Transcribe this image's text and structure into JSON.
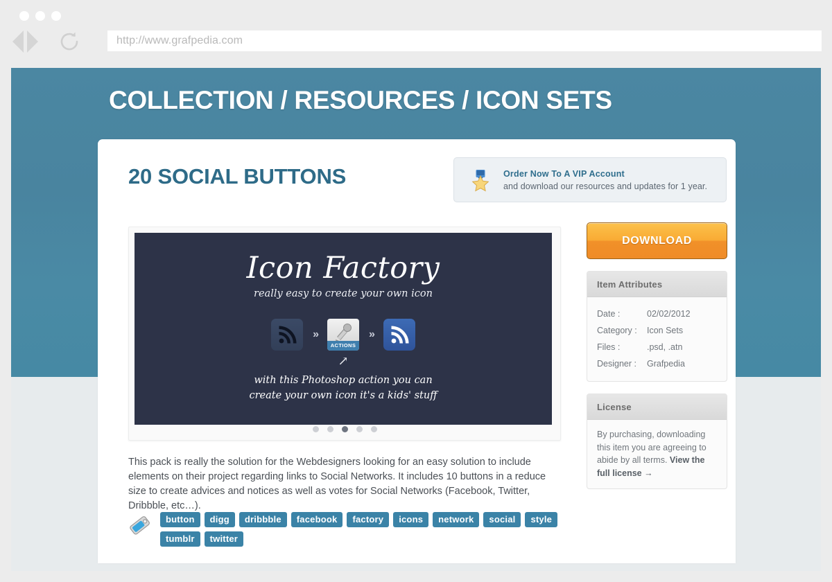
{
  "browser": {
    "url": "http://www.grafpedia.com",
    "url_placeholder": "http://www.grafpedia.com",
    "back_icon": "back-triangle-icon",
    "forward_icon": "forward-triangle-icon",
    "reload_icon": "reload-icon"
  },
  "hero": {
    "breadcrumb": "COLLECTION / RESOURCES / ICON SETS",
    "bg_color": "#4a87a2"
  },
  "item": {
    "title": "20 SOCIAL BUTTONS",
    "description": "This pack is really the solution for the Webdesigners looking for an easy solution to include elements on their project regarding links to Social Networks. It includes 10 buttons in a reduce size to create advices and notices as well as votes for Social Networks (Facebook, Twitter, Dribbble, etc…)."
  },
  "vip": {
    "icon": "vip-star-medal-icon",
    "title": "Order Now To A VIP Account",
    "subtitle": "and download our resources and updates for 1 year.",
    "title_color": "#2f6e8d"
  },
  "preview": {
    "title": "Icon Factory",
    "subtitle": "really easy to create your own icon",
    "actions_label": "ACTIONS",
    "separator": "»",
    "arrow": "↗",
    "caption_line1": "with this Photoshop action you can",
    "caption_line2": "create your own icon it's a kids' stuff",
    "bg_color": "#2d3348",
    "dots": [
      {
        "active": false
      },
      {
        "active": false
      },
      {
        "active": true
      },
      {
        "active": false
      },
      {
        "active": false
      }
    ]
  },
  "sidebar": {
    "download_label": "DOWNLOAD",
    "download_color": "#f5a22f",
    "attributes": {
      "header": "Item Attributes",
      "rows": [
        {
          "key": "Date :",
          "value": "02/02/2012"
        },
        {
          "key": "Category :",
          "value": "Icon Sets"
        },
        {
          "key": "Files :",
          "value": ".psd, .atn"
        },
        {
          "key": "Designer :",
          "value": "Grafpedia"
        }
      ]
    },
    "license": {
      "header": "License",
      "text": "By purchasing, downloading this item you are agreeing to abide by all terms. ",
      "link": "View the full license →"
    }
  },
  "tags": {
    "icon": "tag-label-icon",
    "items": [
      "button",
      "digg",
      "dribbble",
      "facebook",
      "factory",
      "icons",
      "network",
      "social",
      "style",
      "tumblr",
      "twitter"
    ],
    "color": "#3b83a7"
  }
}
